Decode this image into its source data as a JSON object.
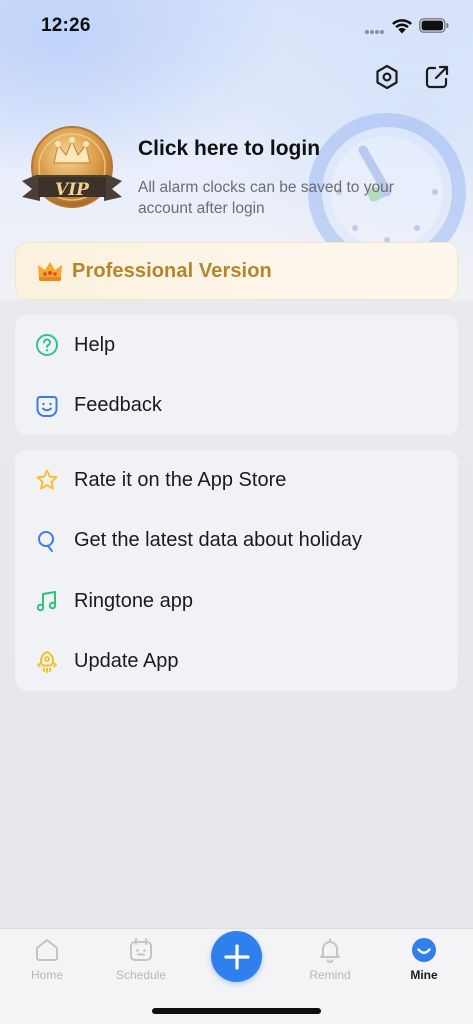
{
  "status_bar": {
    "time": "12:26"
  },
  "profile": {
    "badge_text": "VIP",
    "login_title": "Click here to login",
    "login_subtitle": "All alarm clocks can be saved to your account after login"
  },
  "professional": {
    "label": "Professional Version"
  },
  "menu_group_1": [
    {
      "label": "Help",
      "icon": "help-circle-icon"
    },
    {
      "label": "Feedback",
      "icon": "smile-face-icon"
    }
  ],
  "menu_group_2": [
    {
      "label": "Rate it on the App Store",
      "icon": "star-icon"
    },
    {
      "label": "Get the latest data about holiday",
      "icon": "q-search-icon"
    },
    {
      "label": "Ringtone app",
      "icon": "music-note-icon"
    },
    {
      "label": "Update App",
      "icon": "rocket-icon"
    }
  ],
  "tab_bar": {
    "tabs": [
      {
        "label": "Home",
        "icon": "home-icon"
      },
      {
        "label": "Schedule",
        "icon": "calendar-icon"
      },
      {
        "label": "Remind",
        "icon": "bell-icon"
      },
      {
        "label": "Mine",
        "icon": "smile-icon"
      }
    ],
    "active": "Mine"
  },
  "colors": {
    "accent": "#2f80ed",
    "pro_gold": "#b5852b",
    "help_green": "#2fc48d",
    "feedback_blue": "#3f7be6",
    "star_yellow": "#f2c230",
    "ringtone_green": "#30c07a",
    "update_yellow": "#f3c028"
  }
}
